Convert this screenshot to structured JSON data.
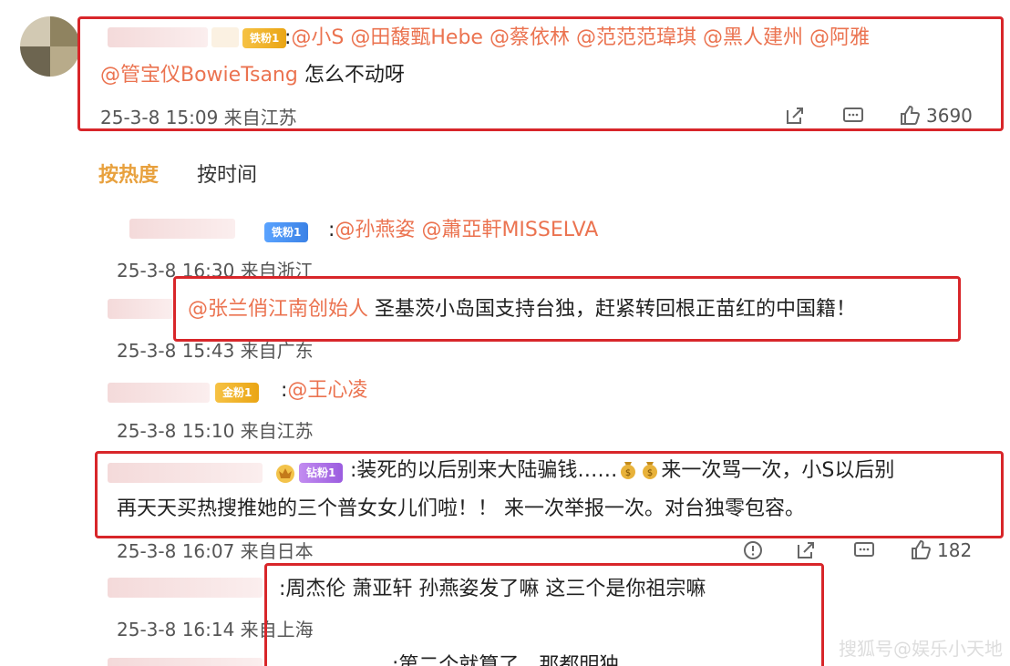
{
  "top_comment": {
    "badge": "铁粉1",
    "text_prefix": ":",
    "mentions_line1": [
      "@小S",
      "@田馥甄Hebe",
      "@蔡依林",
      "@范范范瑋琪",
      "@黑人建州",
      "@阿雅"
    ],
    "mention_line2": "@管宝仪BowieTsang",
    "text_suffix": " 怎么不动呀",
    "timestamp": "25-3-8 15:09 来自江苏",
    "like_count": "3690"
  },
  "sort_tabs": {
    "hot": "按热度",
    "time": "按时间"
  },
  "replies": [
    {
      "badge": "铁粉1",
      "prefix": ":",
      "mentions": [
        "@孙燕姿",
        "@蕭亞軒MISSELVA"
      ],
      "timestamp": "25-3-8 16:30 来自浙江"
    },
    {
      "mention": "@张兰俏江南创始人",
      "text": " 圣基茨小岛国支持台独，赶紧转回根正苗红的中国籍！",
      "timestamp": "25-3-8 15:43 来自广东"
    },
    {
      "badge": "金粉1",
      "prefix": ":",
      "mention": "@王心凌",
      "timestamp": "25-3-8 15:10 来自江苏"
    },
    {
      "badge": "钻粉1",
      "line1_a": ":装死的以后别来大陆骗钱……",
      "line1_b": "来一次骂一次，小S以后别",
      "line2": "再天天买热搜推她的三个普女女儿们啦！！ 来一次举报一次。对台独零包容。",
      "timestamp": "25-3-8 16:07 来自日本",
      "like_count": "182"
    },
    {
      "text": ":周杰伦 萧亚轩 孙燕姿发了嘛 这三个是你祖宗嘛",
      "timestamp": "25-3-8 16:14 来自上海"
    },
    {
      "text": ":第二个就算了，那都明独"
    }
  ],
  "colors": {
    "accent": "#eb7350",
    "highlight_box": "#d8262a",
    "active_tab": "#e8a13e"
  },
  "icons": [
    "share-icon",
    "comment-icon",
    "like-icon",
    "report-icon",
    "money-bag-icon"
  ],
  "watermark": "搜狐号@娱乐小天地"
}
